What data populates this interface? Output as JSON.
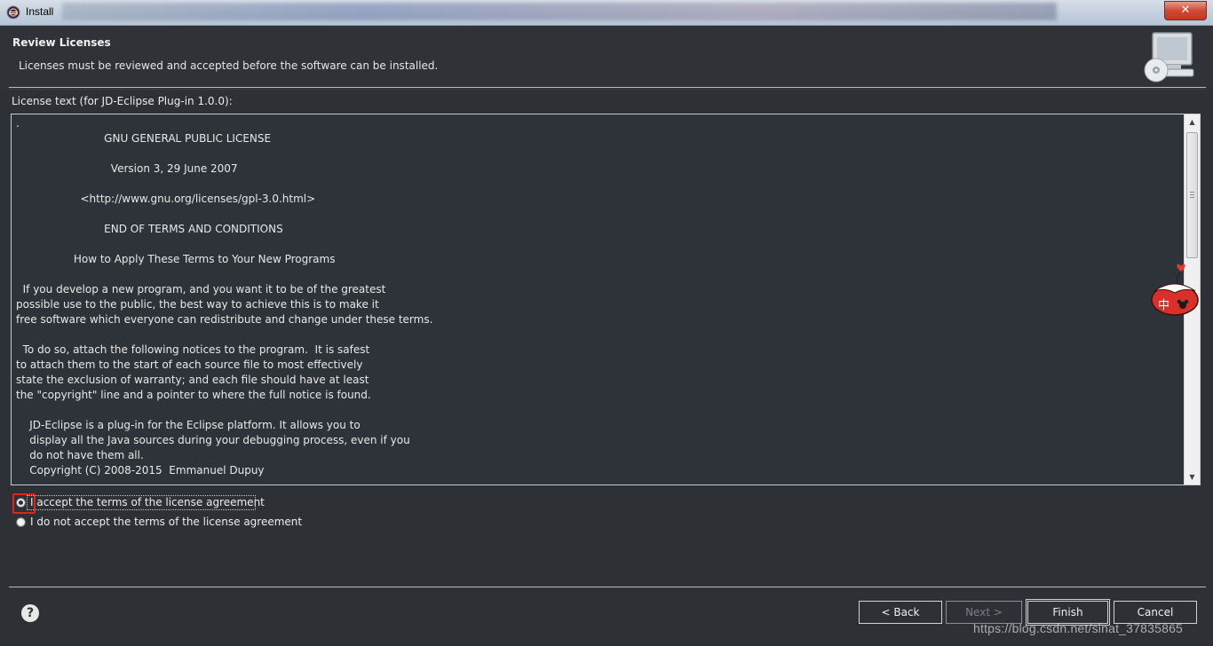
{
  "window": {
    "title": "Install",
    "close_glyph": "✕"
  },
  "header": {
    "title": "Review Licenses",
    "description": "Licenses must be reviewed and accepted before the software can be installed."
  },
  "license": {
    "label": "License text (for JD-Eclipse Plug-in 1.0.0):",
    "text": ".\n                          GNU GENERAL PUBLIC LICENSE\n\n                            Version 3, 29 June 2007\n\n                   <http://www.gnu.org/licenses/gpl-3.0.html>\n\n                          END OF TERMS AND CONDITIONS\n\n                 How to Apply These Terms to Your New Programs\n\n  If you develop a new program, and you want it to be of the greatest\npossible use to the public, the best way to achieve this is to make it\nfree software which everyone can redistribute and change under these terms.\n\n  To do so, attach the following notices to the program.  It is safest\nto attach them to the start of each source file to most effectively\nstate the exclusion of warranty; and each file should have at least\nthe \"copyright\" line and a pointer to where the full notice is found.\n\n    JD-Eclipse is a plug-in for the Eclipse platform. It allows you to\n    display all the Java sources during your debugging process, even if you\n    do not have them all.\n    Copyright (C) 2008-2015  Emmanuel Dupuy"
  },
  "options": {
    "accept": "I accept the terms of the license agreement",
    "decline": "I do not accept the terms of the license agreement",
    "selected": "accept"
  },
  "buttons": {
    "back": "< Back",
    "next": "Next >",
    "finish": "Finish",
    "cancel": "Cancel",
    "help": "?"
  },
  "mascot": {
    "label": "中"
  },
  "watermark": "https://blog.csdn.net/sinat_37835865"
}
